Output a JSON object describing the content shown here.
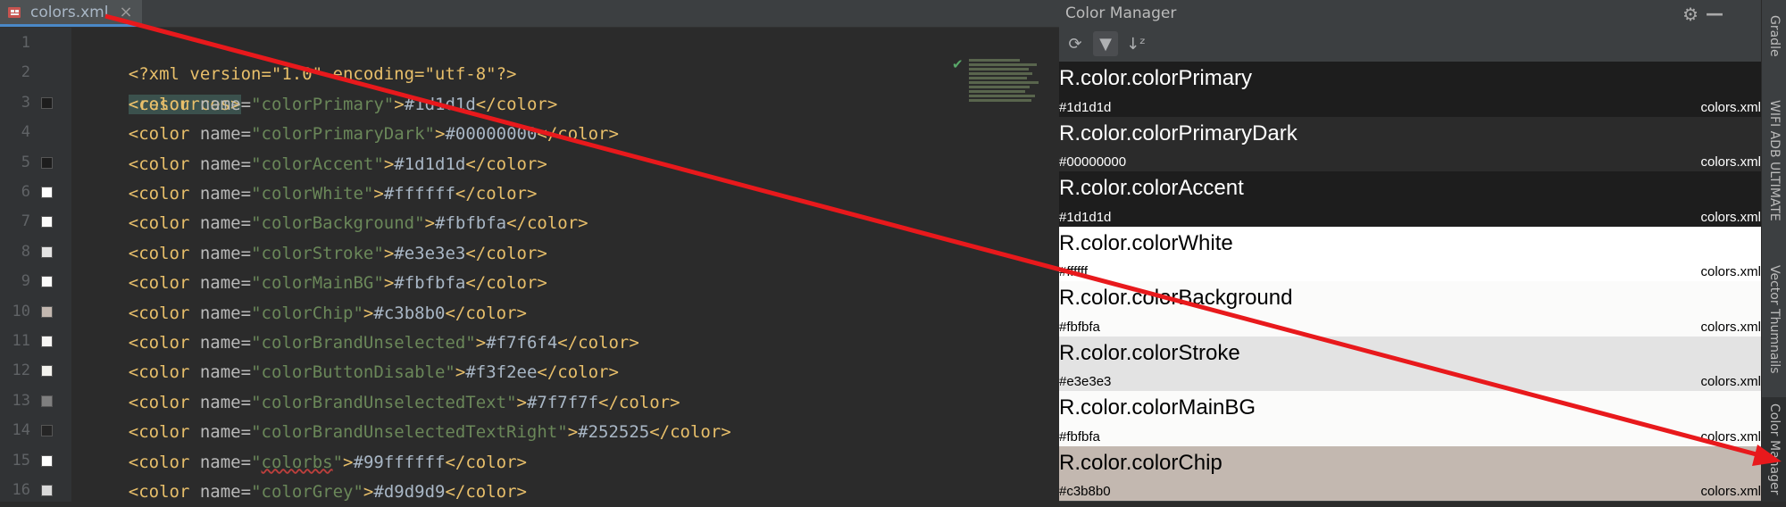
{
  "editor": {
    "tab": {
      "label": "colors.xml",
      "close": "×"
    },
    "lines": [
      {
        "no": "1",
        "swatch": ""
      },
      {
        "no": "2",
        "swatch": ""
      },
      {
        "no": "3",
        "swatch": "#1d1d1d"
      },
      {
        "no": "4",
        "swatch": ""
      },
      {
        "no": "5",
        "swatch": "#1d1d1d"
      },
      {
        "no": "6",
        "swatch": "#ffffff"
      },
      {
        "no": "7",
        "swatch": "#fbfbfa"
      },
      {
        "no": "8",
        "swatch": "#e3e3e3"
      },
      {
        "no": "9",
        "swatch": "#fbfbfa"
      },
      {
        "no": "10",
        "swatch": "#c3b8b0"
      },
      {
        "no": "11",
        "swatch": "#f7f6f4"
      },
      {
        "no": "12",
        "swatch": "#f3f2ee"
      },
      {
        "no": "13",
        "swatch": "#7f7f7f"
      },
      {
        "no": "14",
        "swatch": "#252525"
      },
      {
        "no": "15",
        "swatch": "#ffffff"
      },
      {
        "no": "16",
        "swatch": "#d9d9d9"
      }
    ],
    "xml_decl": "<?xml version=\"1.0\" encoding=\"utf-8\"?>",
    "resources_open": "<resources>",
    "colors": [
      {
        "name": "colorPrimary",
        "value": "#1d1d1d"
      },
      {
        "name": "colorPrimaryDark",
        "value": "#00000000"
      },
      {
        "name": "colorAccent",
        "value": "#1d1d1d"
      },
      {
        "name": "colorWhite",
        "value": "#ffffff"
      },
      {
        "name": "colorBackground",
        "value": "#fbfbfa"
      },
      {
        "name": "colorStroke",
        "value": "#e3e3e3"
      },
      {
        "name": "colorMainBG",
        "value": "#fbfbfa"
      },
      {
        "name": "colorChip",
        "value": "#c3b8b0"
      },
      {
        "name": "colorBrandUnselected",
        "value": "#f7f6f4"
      },
      {
        "name": "colorButtonDisable",
        "value": "#f3f2ee"
      },
      {
        "name": "colorBrandUnselectedText",
        "value": "#7f7f7f"
      },
      {
        "name": "colorBrandUnselectedTextRight",
        "value": "#252525"
      },
      {
        "name": "colorbs",
        "value": "#99ffffff"
      },
      {
        "name": "colorGrey",
        "value": "#d9d9d9"
      }
    ]
  },
  "color_manager": {
    "title": "Color Manager",
    "toolbar": {
      "refresh": "⟳",
      "filter": "▼",
      "sort": "↓ᶻ"
    },
    "items": [
      {
        "name": "R.color.colorPrimary",
        "hex": "#1d1d1d",
        "file": "colors.xml",
        "bg": "#1d1d1d",
        "fg": "#ffffff"
      },
      {
        "name": "R.color.colorPrimaryDark",
        "hex": "#00000000",
        "file": "colors.xml",
        "bg": "#2b2b2b",
        "fg": "#ffffff"
      },
      {
        "name": "R.color.colorAccent",
        "hex": "#1d1d1d",
        "file": "colors.xml",
        "bg": "#1d1d1d",
        "fg": "#ffffff"
      },
      {
        "name": "R.color.colorWhite",
        "hex": "#ffffff",
        "file": "colors.xml",
        "bg": "#ffffff",
        "fg": "#000000"
      },
      {
        "name": "R.color.colorBackground",
        "hex": "#fbfbfa",
        "file": "colors.xml",
        "bg": "#fbfbfa",
        "fg": "#000000"
      },
      {
        "name": "R.color.colorStroke",
        "hex": "#e3e3e3",
        "file": "colors.xml",
        "bg": "#e3e3e3",
        "fg": "#000000"
      },
      {
        "name": "R.color.colorMainBG",
        "hex": "#fbfbfa",
        "file": "colors.xml",
        "bg": "#fbfbfa",
        "fg": "#000000"
      },
      {
        "name": "R.color.colorChip",
        "hex": "#c3b8b0",
        "file": "colors.xml",
        "bg": "#c3b8b0",
        "fg": "#000000"
      }
    ]
  },
  "side_strip": [
    {
      "label": "Gradle",
      "icon": "gradle-icon"
    },
    {
      "label": "WIFI ADB ULTIMATE",
      "icon": "wifi-adb-icon"
    },
    {
      "label": "Vector Thumnails",
      "icon": "vector-thumbnails-icon"
    },
    {
      "label": "Color Manager",
      "icon": "color-manager-icon"
    }
  ],
  "colors": {
    "arrow": "#e8191c",
    "editor_bg": "#2b2b2b",
    "panel_bg": "#3c3f41"
  }
}
